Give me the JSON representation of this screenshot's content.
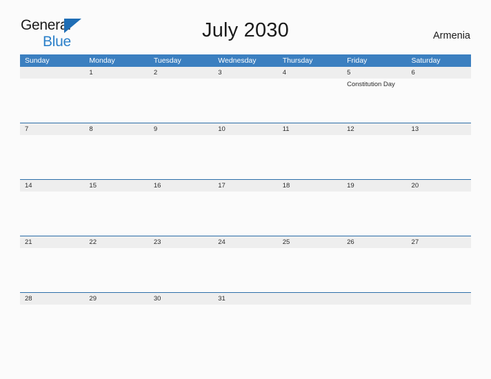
{
  "brand": {
    "line1": "General",
    "line2": "Blue",
    "triangle_color": "#1f6eb5",
    "line2_color": "#2a7fc9"
  },
  "header": {
    "title": "July 2030",
    "country": "Armenia"
  },
  "colors": {
    "header_blue": "#3b7fc0",
    "week_rule_blue": "#2a6da8",
    "date_strip_gray": "#eeeeee",
    "page_background": "#fbfbfb",
    "text": "#2b2b2b"
  },
  "calendar": {
    "day_headers": [
      "Sunday",
      "Monday",
      "Tuesday",
      "Wednesday",
      "Thursday",
      "Friday",
      "Saturday"
    ],
    "weeks": [
      {
        "days": [
          {
            "num": "",
            "event": ""
          },
          {
            "num": "1",
            "event": ""
          },
          {
            "num": "2",
            "event": ""
          },
          {
            "num": "3",
            "event": ""
          },
          {
            "num": "4",
            "event": ""
          },
          {
            "num": "5",
            "event": "Constitution Day"
          },
          {
            "num": "6",
            "event": ""
          }
        ]
      },
      {
        "days": [
          {
            "num": "7",
            "event": ""
          },
          {
            "num": "8",
            "event": ""
          },
          {
            "num": "9",
            "event": ""
          },
          {
            "num": "10",
            "event": ""
          },
          {
            "num": "11",
            "event": ""
          },
          {
            "num": "12",
            "event": ""
          },
          {
            "num": "13",
            "event": ""
          }
        ]
      },
      {
        "days": [
          {
            "num": "14",
            "event": ""
          },
          {
            "num": "15",
            "event": ""
          },
          {
            "num": "16",
            "event": ""
          },
          {
            "num": "17",
            "event": ""
          },
          {
            "num": "18",
            "event": ""
          },
          {
            "num": "19",
            "event": ""
          },
          {
            "num": "20",
            "event": ""
          }
        ]
      },
      {
        "days": [
          {
            "num": "21",
            "event": ""
          },
          {
            "num": "22",
            "event": ""
          },
          {
            "num": "23",
            "event": ""
          },
          {
            "num": "24",
            "event": ""
          },
          {
            "num": "25",
            "event": ""
          },
          {
            "num": "26",
            "event": ""
          },
          {
            "num": "27",
            "event": ""
          }
        ]
      },
      {
        "days": [
          {
            "num": "28",
            "event": ""
          },
          {
            "num": "29",
            "event": ""
          },
          {
            "num": "30",
            "event": ""
          },
          {
            "num": "31",
            "event": ""
          },
          {
            "num": "",
            "event": ""
          },
          {
            "num": "",
            "event": ""
          },
          {
            "num": "",
            "event": ""
          }
        ]
      }
    ]
  }
}
